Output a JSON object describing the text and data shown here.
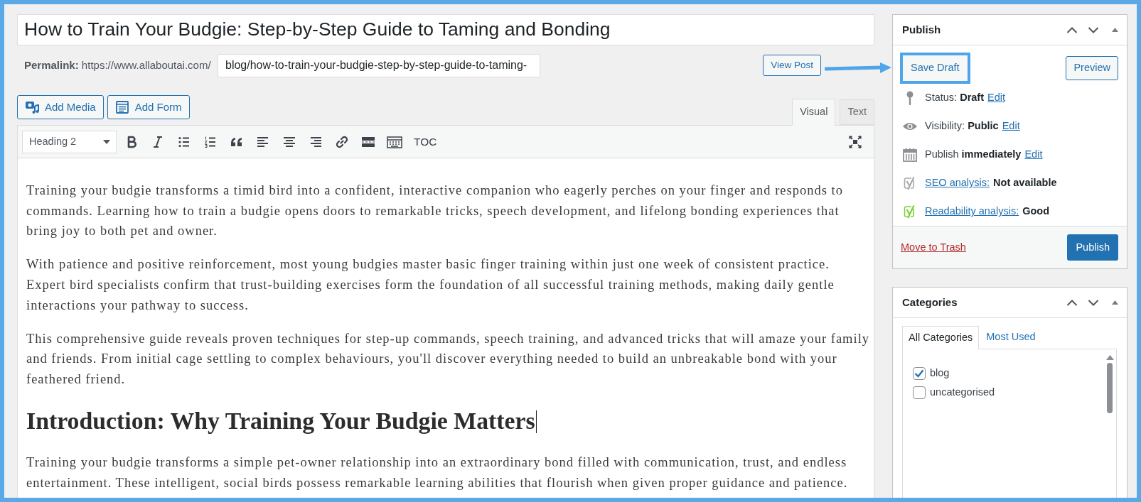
{
  "post": {
    "title": "How to Train Your Budgie: Step-by-Step Guide to Taming and Bonding",
    "permalink_label": "Permalink:",
    "permalink_base": "https://www.allaboutai.com/",
    "permalink_slug": "blog/how-to-train-your-budgie-step-by-step-guide-to-taming-",
    "view_post_button": "View Post"
  },
  "pointer_arrow": true,
  "media_buttons": [
    {
      "kind": "media",
      "label": "Add Media"
    },
    {
      "kind": "form",
      "label": "Add Form"
    }
  ],
  "editor_tabs": [
    {
      "label": "Visual",
      "selected": true
    },
    {
      "label": "Text",
      "selected": false
    }
  ],
  "toolbar": {
    "format": "Heading 2",
    "toc": "TOC"
  },
  "content": [
    {
      "kind": "paragraph",
      "text": "Training your budgie transforms a timid bird into a confident, interactive companion who eagerly perches on your finger and responds to commands. Learning how to train a budgie opens doors to remarkable tricks, speech development, and lifelong bonding experiences that bring joy to both pet and owner.",
      "cursor": false
    },
    {
      "kind": "paragraph",
      "text": "With patience and positive reinforcement, most young budgies master basic finger training within just one week of consistent practice. Expert bird specialists confirm that trust-building exercises form the foundation of all successful training methods, making daily gentle interactions your pathway to success.",
      "cursor": false
    },
    {
      "kind": "paragraph",
      "text": "This comprehensive guide reveals proven techniques for step-up commands, speech training, and advanced tricks that will amaze your family and friends. From initial cage settling to complex behaviours, you'll discover everything needed to build an unbreakable bond with your feathered friend.",
      "cursor": false
    },
    {
      "kind": "heading",
      "text": "Introduction: Why Training Your Budgie Matters",
      "cursor": true
    },
    {
      "kind": "paragraph",
      "text": "Training your budgie transforms a simple pet-owner relationship into an extraordinary bond filled with communication, trust, and endless entertainment. These intelligent, social birds possess remarkable learning abilities that flourish when given proper guidance and patience.",
      "cursor": false
    }
  ],
  "publish": {
    "title": "Publish",
    "actions": [
      {
        "label": "Save Draft",
        "highlighted": true
      },
      {
        "label": "Preview",
        "highlighted": false
      }
    ],
    "misc": [
      {
        "kind": "status",
        "label": "Status:",
        "value": "Draft",
        "link": "Edit"
      },
      {
        "kind": "visibility",
        "label": "Visibility:",
        "value": "Public",
        "link": "Edit"
      },
      {
        "kind": "schedule",
        "label": "Publish",
        "value": "immediately",
        "link": "Edit"
      },
      {
        "kind": "seo",
        "link": "SEO analysis:",
        "value": "Not available",
        "color": "#a7aaad"
      },
      {
        "kind": "readability",
        "link": "Readability analysis:",
        "value": "Good",
        "color": "#7ad03a"
      }
    ],
    "trash_link": "Move to Trash",
    "publish_button": "Publish"
  },
  "categories": {
    "title": "Categories",
    "tabs": [
      {
        "label": "All Categories",
        "selected": true
      },
      {
        "label": "Most Used",
        "selected": false
      }
    ],
    "items": [
      {
        "label": "blog",
        "checked": true
      },
      {
        "label": "uncategorised",
        "checked": false
      }
    ]
  }
}
